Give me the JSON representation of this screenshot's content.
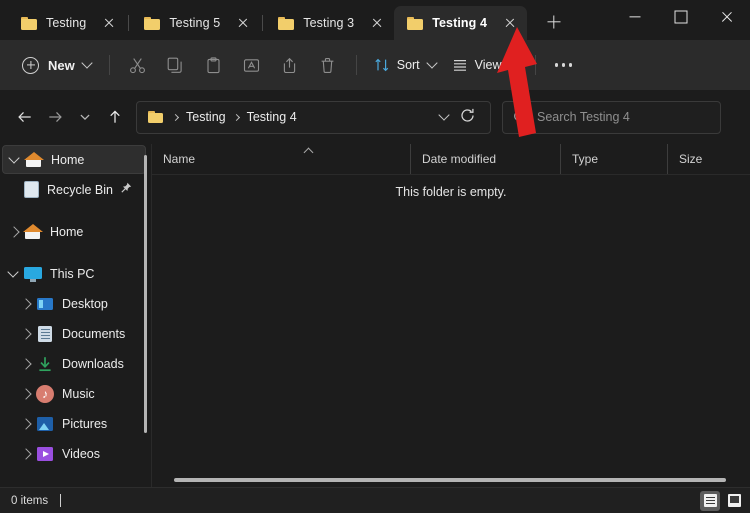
{
  "window": {
    "controls": [
      {
        "name": "minimize",
        "glyph": "minimize-icon"
      },
      {
        "name": "maximize",
        "glyph": "maximize-icon"
      },
      {
        "name": "close",
        "glyph": "close-icon"
      }
    ]
  },
  "tabs": {
    "items": [
      {
        "label": "Testing",
        "active": false,
        "icon": "folder-icon"
      },
      {
        "label": "Testing 5",
        "active": false,
        "icon": "folder-icon"
      },
      {
        "label": "Testing 3",
        "active": false,
        "icon": "folder-icon"
      },
      {
        "label": "Testing 4",
        "active": true,
        "icon": "folder-icon"
      }
    ],
    "close_label": "Close tab",
    "new_tab_label": "Add new tab"
  },
  "toolbar": {
    "new_label": "New",
    "sort_label": "Sort",
    "view_label": "View",
    "see_more_label": "See more",
    "tools": [
      {
        "name": "cut",
        "label": "Cut"
      },
      {
        "name": "copy",
        "label": "Copy"
      },
      {
        "name": "paste",
        "label": "Paste"
      },
      {
        "name": "rename",
        "label": "Rename"
      },
      {
        "name": "share",
        "label": "Share"
      },
      {
        "name": "delete",
        "label": "Delete"
      }
    ]
  },
  "navigation": {
    "back_label": "Back",
    "forward_label": "Forward",
    "recent_label": "Recent locations",
    "up_label": "Up to Testing"
  },
  "address": {
    "crumbs": [
      "Testing",
      "Testing 4"
    ],
    "dropdown_label": "Previous locations",
    "refresh_label": "Refresh"
  },
  "search": {
    "placeholder": "Search Testing 4"
  },
  "sidebar": {
    "items": [
      {
        "label": "Home",
        "icon": "home-icon",
        "twisty": "open",
        "indent": 0,
        "selected": true,
        "pinned": false
      },
      {
        "label": "Recycle Bin",
        "icon": "recycle-bin-icon",
        "twisty": "none",
        "indent": 1,
        "selected": false,
        "pinned": true
      },
      {
        "label": "Home",
        "icon": "home-icon",
        "twisty": "closed",
        "indent": 0,
        "selected": false,
        "pinned": false
      },
      {
        "label": "This PC",
        "icon": "monitor-icon",
        "twisty": "open",
        "indent": 0,
        "selected": false,
        "pinned": false
      },
      {
        "label": "Desktop",
        "icon": "desktop-icon",
        "twisty": "closed",
        "indent": 1,
        "selected": false,
        "pinned": false
      },
      {
        "label": "Documents",
        "icon": "documents-icon",
        "twisty": "closed",
        "indent": 1,
        "selected": false,
        "pinned": false
      },
      {
        "label": "Downloads",
        "icon": "downloads-icon",
        "twisty": "closed",
        "indent": 1,
        "selected": false,
        "pinned": false
      },
      {
        "label": "Music",
        "icon": "music-icon",
        "twisty": "closed",
        "indent": 1,
        "selected": false,
        "pinned": false
      },
      {
        "label": "Pictures",
        "icon": "pictures-icon",
        "twisty": "closed",
        "indent": 1,
        "selected": false,
        "pinned": false
      },
      {
        "label": "Videos",
        "icon": "videos-icon",
        "twisty": "closed",
        "indent": 1,
        "selected": false,
        "pinned": false
      }
    ]
  },
  "filelist": {
    "columns": [
      {
        "label": "Name",
        "sorted": "asc"
      },
      {
        "label": "Date modified",
        "sorted": ""
      },
      {
        "label": "Type",
        "sorted": ""
      },
      {
        "label": "Size",
        "sorted": ""
      }
    ],
    "empty_message": "This folder is empty.",
    "rows": []
  },
  "statusbar": {
    "item_count": "0 items",
    "details_view_label": "Details view",
    "large_icons_view_label": "Large icons view"
  },
  "annotation": {
    "type": "arrow",
    "color": "#e02020",
    "points_at": "active-tab-close-button"
  }
}
